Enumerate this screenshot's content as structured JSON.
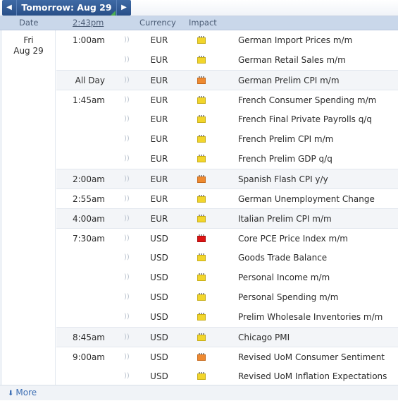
{
  "nav": {
    "prev_icon": "triangle-left-icon",
    "next_icon": "triangle-right-icon",
    "title": "Tomorrow: Aug 29"
  },
  "header": {
    "date": "Date",
    "time": "2:43pm",
    "currency": "Currency",
    "impact": "Impact"
  },
  "day": {
    "weekday": "Fri",
    "date": "Aug 29"
  },
  "colors": {
    "low": "#f2d52b",
    "medium": "#ee8a30",
    "high": "#dd1414",
    "accent": "#284f88"
  },
  "events": [
    {
      "time": "1:00am",
      "currency": "EUR",
      "impact": "low",
      "title": "German Import Prices m/m"
    },
    {
      "time": "",
      "currency": "EUR",
      "impact": "low",
      "title": "German Retail Sales m/m"
    },
    {
      "time": "All Day",
      "currency": "EUR",
      "impact": "medium",
      "title": "German Prelim CPI m/m"
    },
    {
      "time": "1:45am",
      "currency": "EUR",
      "impact": "low",
      "title": "French Consumer Spending m/m"
    },
    {
      "time": "",
      "currency": "EUR",
      "impact": "low",
      "title": "French Final Private Payrolls q/q"
    },
    {
      "time": "",
      "currency": "EUR",
      "impact": "low",
      "title": "French Prelim CPI m/m"
    },
    {
      "time": "",
      "currency": "EUR",
      "impact": "low",
      "title": "French Prelim GDP q/q"
    },
    {
      "time": "2:00am",
      "currency": "EUR",
      "impact": "medium",
      "title": "Spanish Flash CPI y/y"
    },
    {
      "time": "2:55am",
      "currency": "EUR",
      "impact": "low",
      "title": "German Unemployment Change"
    },
    {
      "time": "4:00am",
      "currency": "EUR",
      "impact": "low",
      "title": "Italian Prelim CPI m/m"
    },
    {
      "time": "7:30am",
      "currency": "USD",
      "impact": "high",
      "title": "Core PCE Price Index m/m"
    },
    {
      "time": "",
      "currency": "USD",
      "impact": "low",
      "title": "Goods Trade Balance"
    },
    {
      "time": "",
      "currency": "USD",
      "impact": "low",
      "title": "Personal Income m/m"
    },
    {
      "time": "",
      "currency": "USD",
      "impact": "low",
      "title": "Personal Spending m/m"
    },
    {
      "time": "",
      "currency": "USD",
      "impact": "low",
      "title": "Prelim Wholesale Inventories m/m"
    },
    {
      "time": "8:45am",
      "currency": "USD",
      "impact": "low",
      "title": "Chicago PMI"
    },
    {
      "time": "9:00am",
      "currency": "USD",
      "impact": "medium",
      "title": "Revised UoM Consumer Sentiment"
    },
    {
      "time": "",
      "currency": "USD",
      "impact": "low",
      "title": "Revised UoM Inflation Expectations"
    }
  ],
  "footer": {
    "more_label": "More",
    "more_icon": "down-arrow-icon"
  }
}
